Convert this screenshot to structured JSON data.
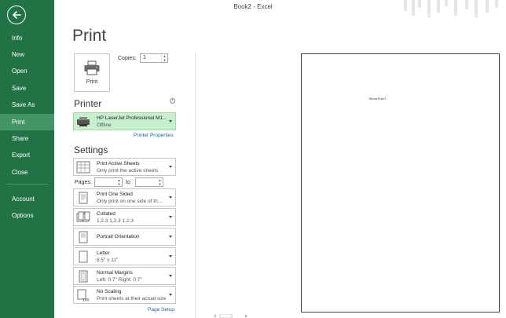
{
  "window": {
    "title": "Book2 - Excel"
  },
  "sidebar": {
    "items": [
      {
        "label": "Info"
      },
      {
        "label": "New"
      },
      {
        "label": "Open"
      },
      {
        "label": "Save"
      },
      {
        "label": "Save As"
      },
      {
        "label": "Print",
        "selected": true
      },
      {
        "label": "Share"
      },
      {
        "label": "Export"
      },
      {
        "label": "Close"
      },
      {
        "label": "Account"
      },
      {
        "label": "Options"
      }
    ]
  },
  "page": {
    "title": "Print"
  },
  "print_button": {
    "label": "Print",
    "icon": "printer-icon"
  },
  "copies": {
    "label": "Copies:",
    "value": "1"
  },
  "printer": {
    "heading": "Printer",
    "name": "HP LaserJet Professional M1...",
    "status": "Offline",
    "properties_link": "Printer Properties"
  },
  "settings": {
    "heading": "Settings",
    "what": {
      "title": "Print Active Sheets",
      "subtitle": "Only print the active sheets"
    },
    "pages": {
      "label": "Pages:",
      "to": "to",
      "from_value": "",
      "to_value": ""
    },
    "sides": {
      "title": "Print One Sided",
      "subtitle": "Only print on one side of th..."
    },
    "collation": {
      "title": "Collated",
      "subtitle": "1,2,3    1,2,3    1,2,3"
    },
    "orientation": {
      "title": "Portrait Orientation"
    },
    "paper": {
      "title": "Letter",
      "subtitle": "8.5\" x 11\""
    },
    "margins": {
      "title": "Normal Margins",
      "subtitle": "Left:  0.7\"    Right:  0.7\""
    },
    "scaling": {
      "title": "No Scaling",
      "subtitle": "Print sheets at their actual size"
    },
    "page_setup_link": "Page Setup"
  },
  "preview": {
    "content": "TeKeeTeeeT"
  },
  "colors": {
    "accent": "#217346",
    "selected": "#439467",
    "printer_bg": "#c6efce"
  }
}
